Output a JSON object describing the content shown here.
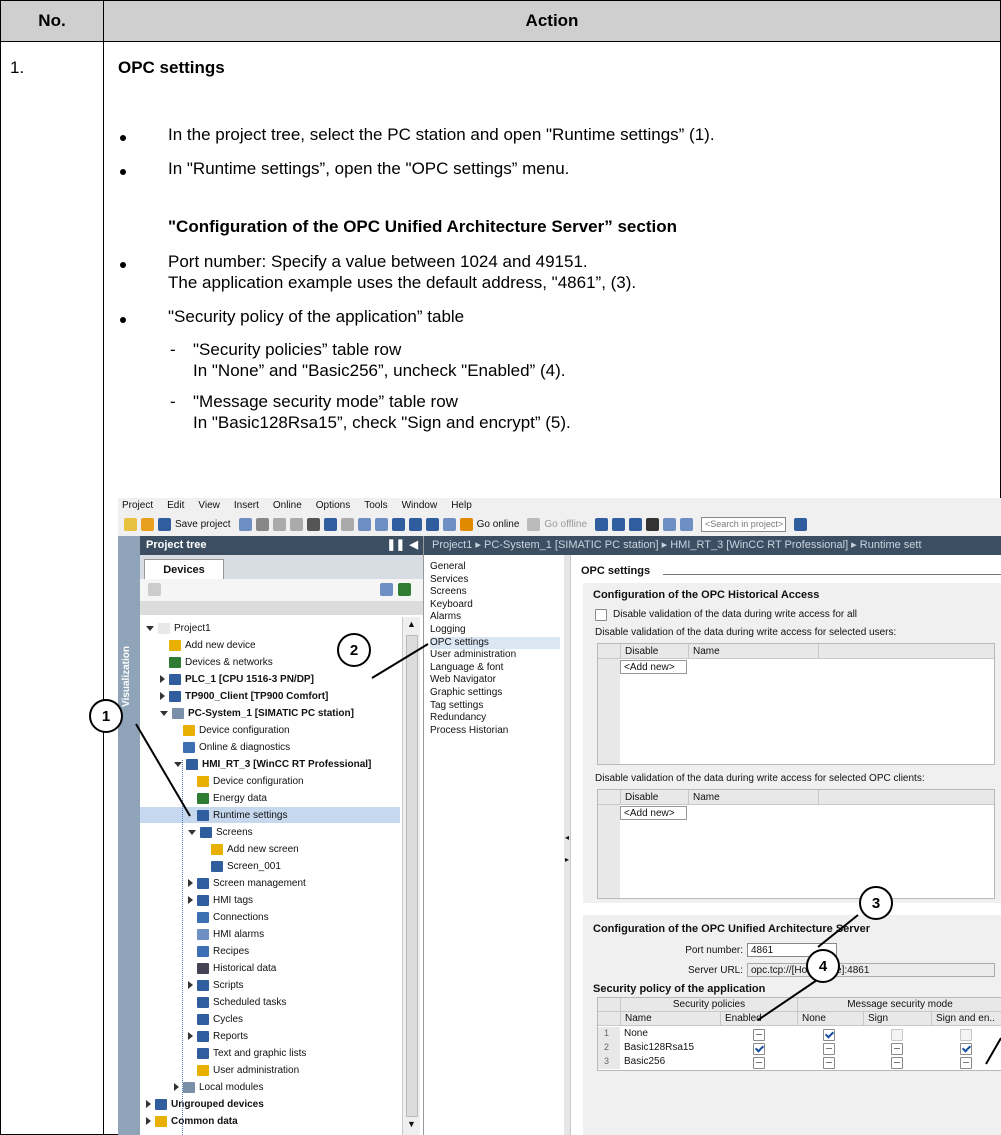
{
  "table": {
    "col_no": "No.",
    "col_action": "Action",
    "row_no": "1.",
    "heading": "OPC settings",
    "bullets": [
      "In the project tree, select the PC station and open \"Runtime settings” (1).",
      "In \"Runtime settings”, open the \"OPC settings” menu."
    ],
    "subheading": "\"Configuration of the OPC Unified Architecture Server” section",
    "port_line1": "Port number: Specify a value between 1024 and 49151.",
    "port_line2": "The application example uses the default address, \"4861”, (3).",
    "policy_bullet": "\"Security policy of the application” table",
    "sub1_line1": "\"Security policies” table row",
    "sub1_line2": "In \"None” and \"Basic256”, uncheck \"Enabled” (4).",
    "sub2_line1": "\"Message security mode” table row",
    "sub2_line2": "In \"Basic128Rsa15”, check \"Sign and encrypt” (5).",
    "dash": "-"
  },
  "tia": {
    "menu": [
      "Project",
      "Edit",
      "View",
      "Insert",
      "Online",
      "Options",
      "Tools",
      "Window",
      "Help"
    ],
    "toolbar": {
      "save": "Save project",
      "go_online": "Go online",
      "go_offline": "Go offline",
      "search_placeholder": "<Search in project>"
    },
    "project_tree_title": "Project tree",
    "devices_tab": "Devices",
    "visualization_tab": "Visualization",
    "breadcrumb": "Project1 ▸ PC-System_1 [SIMATIC PC station] ▸ HMI_RT_3 [WinCC RT Professional] ▸ Runtime sett",
    "tree": [
      {
        "label": "Project1",
        "level": 0,
        "arrow": "down",
        "color": "#e8e8e8"
      },
      {
        "label": "Add new device",
        "level": 1,
        "arrow": "",
        "color": "#e8b000"
      },
      {
        "label": "Devices & networks",
        "level": 1,
        "arrow": "",
        "color": "#2e7d32"
      },
      {
        "label": "PLC_1 [CPU 1516-3 PN/DP]",
        "level": 1,
        "arrow": "right",
        "color": "#2f5d9e",
        "bold": true
      },
      {
        "label": "TP900_Client [TP900 Comfort]",
        "level": 1,
        "arrow": "right",
        "color": "#2f5d9e",
        "bold": true
      },
      {
        "label": "PC-System_1 [SIMATIC PC station]",
        "level": 1,
        "arrow": "down",
        "color": "#7a8fa8",
        "bold": true
      },
      {
        "label": "Device configuration",
        "level": 2,
        "arrow": "",
        "color": "#e8b000"
      },
      {
        "label": "Online & diagnostics",
        "level": 2,
        "arrow": "",
        "color": "#3c6fb4"
      },
      {
        "label": "HMI_RT_3 [WinCC RT Professional]",
        "level": 2,
        "arrow": "down",
        "color": "#2f5d9e",
        "bold": true
      },
      {
        "label": "Device configuration",
        "level": 3,
        "arrow": "",
        "color": "#e8b000"
      },
      {
        "label": "Energy data",
        "level": 3,
        "arrow": "",
        "color": "#2e7d32"
      },
      {
        "label": "Runtime settings",
        "level": 3,
        "arrow": "",
        "color": "#2f5d9e",
        "selected": true
      },
      {
        "label": "Screens",
        "level": 3,
        "arrow": "down",
        "color": "#2f5d9e"
      },
      {
        "label": "Add new screen",
        "level": 4,
        "arrow": "",
        "color": "#e8b000"
      },
      {
        "label": "Screen_001",
        "level": 4,
        "arrow": "",
        "color": "#2f5d9e"
      },
      {
        "label": "Screen management",
        "level": 3,
        "arrow": "right",
        "color": "#2f5d9e"
      },
      {
        "label": "HMI tags",
        "level": 3,
        "arrow": "right",
        "color": "#2f5d9e"
      },
      {
        "label": "Connections",
        "level": 3,
        "arrow": "",
        "color": "#3c6fb4"
      },
      {
        "label": "HMI alarms",
        "level": 3,
        "arrow": "",
        "color": "#6d8fc4"
      },
      {
        "label": "Recipes",
        "level": 3,
        "arrow": "",
        "color": "#3c6fb4"
      },
      {
        "label": "Historical data",
        "level": 3,
        "arrow": "",
        "color": "#445"
      },
      {
        "label": "Scripts",
        "level": 3,
        "arrow": "right",
        "color": "#2f5d9e"
      },
      {
        "label": "Scheduled tasks",
        "level": 3,
        "arrow": "",
        "color": "#2f5d9e"
      },
      {
        "label": "Cycles",
        "level": 3,
        "arrow": "",
        "color": "#2f5d9e"
      },
      {
        "label": "Reports",
        "level": 3,
        "arrow": "right",
        "color": "#2f5d9e"
      },
      {
        "label": "Text and graphic lists",
        "level": 3,
        "arrow": "",
        "color": "#2f5d9e"
      },
      {
        "label": "User administration",
        "level": 3,
        "arrow": "",
        "color": "#e8b000"
      },
      {
        "label": "Local modules",
        "level": 2,
        "arrow": "right",
        "color": "#7a8fa8"
      },
      {
        "label": "Ungrouped devices",
        "level": 0,
        "arrow": "right",
        "color": "#2f5d9e",
        "bold": true
      },
      {
        "label": "Common data",
        "level": 0,
        "arrow": "right",
        "color": "#e8b000",
        "bold": true
      }
    ],
    "nav": [
      "General",
      "Services",
      "Screens",
      "Keyboard",
      "Alarms",
      "Logging",
      "OPC settings",
      "User administration",
      "Language & font",
      "Web Navigator",
      "Graphic settings",
      "Tag settings",
      "Redundancy",
      "Process Historian"
    ],
    "opc_title": "OPC settings",
    "hda_title": "Configuration of the OPC Historical Access",
    "disable_all": "Disable validation of the data during write access for all",
    "disable_users": "Disable validation of the data during write access for selected users:",
    "disable_clients": "Disable validation of the data during write access for selected OPC clients:",
    "col_disable": "Disable",
    "col_name": "Name",
    "add_new": "<Add new>",
    "ua_title": "Configuration of the OPC Unified Architecture Server",
    "port_label": "Port number:",
    "port_value": "4861",
    "url_label": "Server URL:",
    "url_value": "opc.tcp://[HostName]:4861",
    "policy_title": "Security policy of the application",
    "grp_policies": "Security policies",
    "grp_mode": "Message security mode",
    "cols": [
      "Name",
      "Enabled",
      "None",
      "Sign",
      "Sign and en.."
    ],
    "rows": [
      {
        "n": "1",
        "name": "None"
      },
      {
        "n": "2",
        "name": "Basic128Rsa15"
      },
      {
        "n": "3",
        "name": "Basic256"
      }
    ]
  },
  "callouts": [
    "1",
    "2",
    "3",
    "4"
  ]
}
